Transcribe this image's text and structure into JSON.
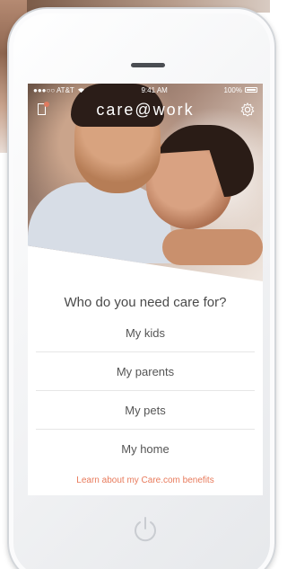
{
  "status_bar": {
    "carrier": "●●●○○ AT&T",
    "time": "9:41 AM",
    "battery": "100%"
  },
  "header": {
    "brand": "care@work",
    "menu_icon": "door-icon",
    "settings_icon": "gear-icon"
  },
  "main": {
    "question": "Who do you need care for?",
    "options": [
      {
        "label": "My kids"
      },
      {
        "label": "My parents"
      },
      {
        "label": "My pets"
      },
      {
        "label": "My home"
      }
    ],
    "benefits_link": "Learn about my Care.com benefits"
  },
  "device": {
    "home_button_icon": "power-icon"
  },
  "colors": {
    "accent": "#e87a5b",
    "text": "#4a4a4a"
  }
}
